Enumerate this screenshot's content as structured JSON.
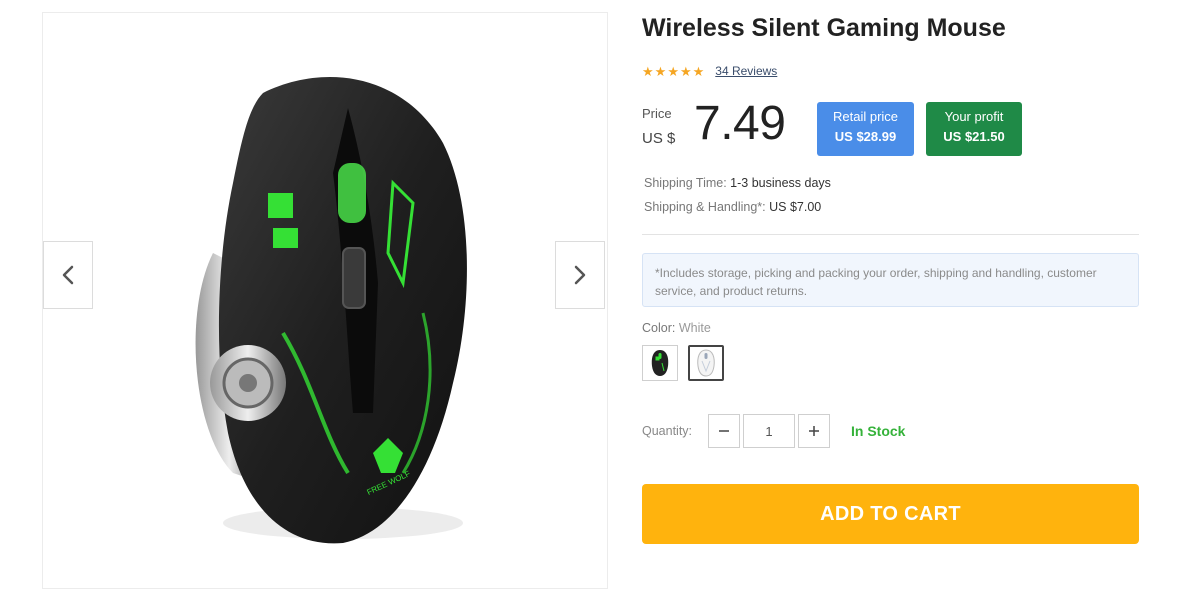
{
  "product": {
    "title": "Wireless Silent Gaming Mouse",
    "rating": 5,
    "reviews_label": "34 Reviews",
    "price_label": "Price",
    "currency_label": "US $",
    "price_value": "7.49",
    "retail": {
      "label": "Retail price",
      "value": "US $28.99",
      "color": "#4a8de8"
    },
    "profit": {
      "label": "Your profit",
      "value": "US $21.50",
      "color": "#1f8a47"
    },
    "shipping_time_label": "Shipping Time:",
    "shipping_time_value": "1-3 business days",
    "shipping_handling_label": "Shipping & Handling*:",
    "shipping_handling_value": "US $7.00",
    "note": "*Includes storage, picking and packing your order, shipping and handling, customer service, and product returns.",
    "color_label": "Color:",
    "color_value": "White",
    "quantity_label": "Quantity:",
    "quantity_value": "1",
    "stock_status": "In Stock",
    "add_to_cart_label": "ADD TO CART"
  },
  "icons": {
    "prev": "chevron-left-icon",
    "next": "chevron-right-icon",
    "star": "star-icon"
  },
  "colors": {
    "accent": "#ffb30d",
    "stock": "#35b23a",
    "star": "#f5a623"
  }
}
